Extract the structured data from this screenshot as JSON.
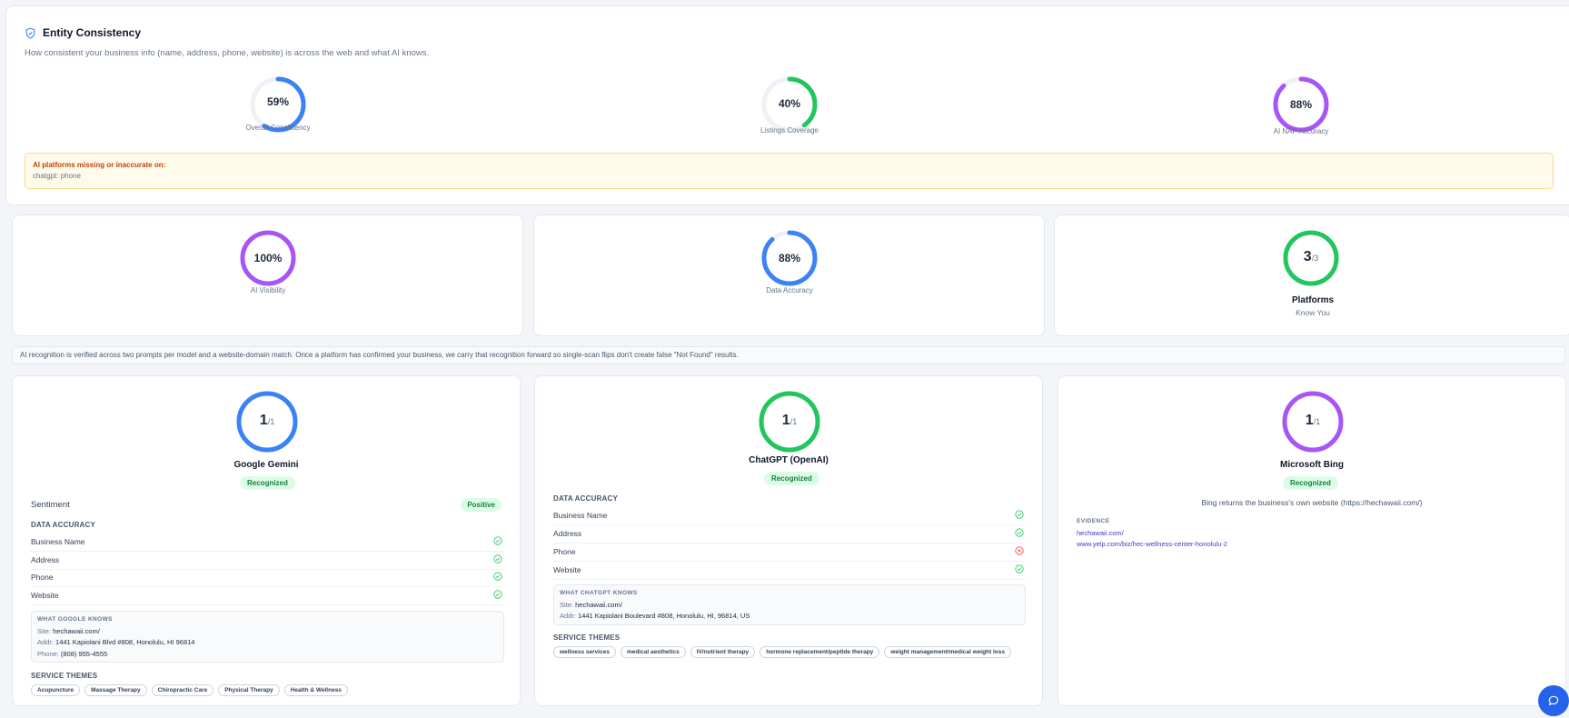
{
  "entity": {
    "title": "Entity Consistency",
    "description": "How consistent your business info (name, address, phone, website) is across the web and what AI knows.",
    "metrics": [
      {
        "value": "59%",
        "percent": 59,
        "label": "Overall Consistency",
        "color": "#3b82f6"
      },
      {
        "value": "40%",
        "percent": 40,
        "label": "Listings Coverage",
        "color": "#22c55e"
      },
      {
        "value": "88%",
        "percent": 88,
        "label": "AI NAP Accuracy",
        "color": "#a855f7"
      }
    ],
    "alert": {
      "title": "AI platforms missing or inaccurate on:",
      "body": "chatgpt: phone"
    }
  },
  "summary": {
    "ai_visibility": {
      "value": "100%",
      "percent": 100,
      "label": "AI Visibility",
      "color": "#a855f7"
    },
    "data_accuracy": {
      "value": "88%",
      "percent": 88,
      "label": "Data Accuracy",
      "color": "#3b82f6"
    },
    "platforms": {
      "count": "3",
      "total": "/3",
      "percent": 100,
      "label": "Platforms",
      "sub": "Know You",
      "color": "#22c55e"
    }
  },
  "note": "AI recognition is verified across two prompts per model and a website-domain match. Once a platform has confirmed your business, we carry that recognition forward so single-scan flips don't create false \"Not Found\" results.",
  "platforms": [
    {
      "count": "1",
      "total": "/1",
      "color": "#3b82f6",
      "name": "Google Gemini",
      "status": "Recognized",
      "sentiment_label": "Sentiment",
      "sentiment_value": "Positive",
      "accuracy_title": "DATA ACCURACY",
      "rows": [
        {
          "label": "Business Name",
          "ok": true
        },
        {
          "label": "Address",
          "ok": true
        },
        {
          "label": "Phone",
          "ok": true
        },
        {
          "label": "Website",
          "ok": true
        }
      ],
      "knows_title": "WHAT GOOGLE KNOWS",
      "knows": [
        {
          "k": "Site:",
          "v": "hechawaii.com/"
        },
        {
          "k": "Addr:",
          "v": "1441 Kapiolani Blvd #808, Honolulu, HI 96814"
        },
        {
          "k": "Phone:",
          "v": "(808) 955-4555"
        }
      ],
      "themes_title": "SERVICE THEMES",
      "themes": [
        "Acupuncture",
        "Massage Therapy",
        "Chiropractic Care",
        "Physical Therapy",
        "Health & Wellness"
      ]
    },
    {
      "count": "1",
      "total": "/1",
      "color": "#22c55e",
      "name": "ChatGPT (OpenAI)",
      "status": "Recognized",
      "accuracy_title": "DATA ACCURACY",
      "rows": [
        {
          "label": "Business Name",
          "ok": true
        },
        {
          "label": "Address",
          "ok": true
        },
        {
          "label": "Phone",
          "ok": false
        },
        {
          "label": "Website",
          "ok": true
        }
      ],
      "knows_title": "WHAT CHATGPT KNOWS",
      "knows": [
        {
          "k": "Site:",
          "v": "hechawaii.com/"
        },
        {
          "k": "Addr:",
          "v": "1441 Kapiolani Boulevard #808, Honolulu, HI, 96814, US"
        }
      ],
      "themes_title": "SERVICE THEMES",
      "themes": [
        "wellness services",
        "medical aesthetics",
        "IV/nutrient therapy",
        "hormone replacement/peptide therapy",
        "weight management/medical weight loss"
      ]
    },
    {
      "count": "1",
      "total": "/1",
      "color": "#a855f7",
      "name": "Microsoft Bing",
      "status": "Recognized",
      "note": "Bing returns the business's own website (https://hechawaii.com/)",
      "evidence_title": "EVIDENCE",
      "evidence": [
        "hechawaii.com/",
        "www.yelp.com/biz/hec-wellness-center-honolulu-2"
      ]
    }
  ]
}
